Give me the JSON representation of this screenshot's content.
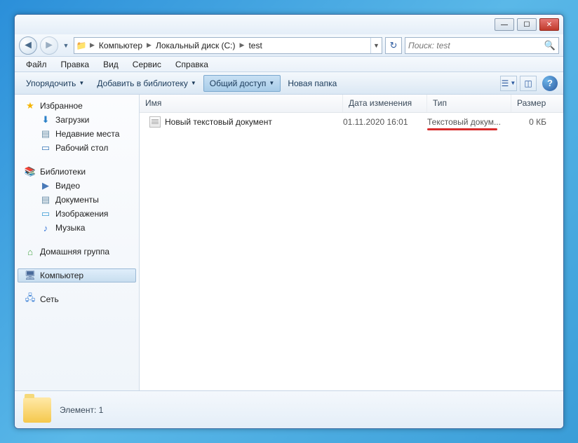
{
  "breadcrumb": {
    "p1": "Компьютер",
    "p2": "Локальный диск (C:)",
    "p3": "test"
  },
  "search": {
    "placeholder": "Поиск: test"
  },
  "menu": {
    "file": "Файл",
    "edit": "Правка",
    "view": "Вид",
    "service": "Сервис",
    "help": "Справка"
  },
  "toolbar": {
    "organize": "Упорядочить",
    "addlib": "Добавить в библиотеку",
    "share": "Общий доступ",
    "newfolder": "Новая папка"
  },
  "sidebar": {
    "favorites": "Избранное",
    "downloads": "Загрузки",
    "recent": "Недавние места",
    "desktop": "Рабочий стол",
    "libraries": "Библиотеки",
    "videos": "Видео",
    "documents": "Документы",
    "pictures": "Изображения",
    "music": "Музыка",
    "homegroup": "Домашняя группа",
    "computer": "Компьютер",
    "network": "Сеть"
  },
  "columns": {
    "name": "Имя",
    "date": "Дата изменения",
    "type": "Тип",
    "size": "Размер"
  },
  "file": {
    "name": "Новый текстовый документ",
    "date": "01.11.2020 16:01",
    "type": "Текстовый докум...",
    "size": "0 КБ"
  },
  "status": {
    "text": "Элемент: 1"
  }
}
